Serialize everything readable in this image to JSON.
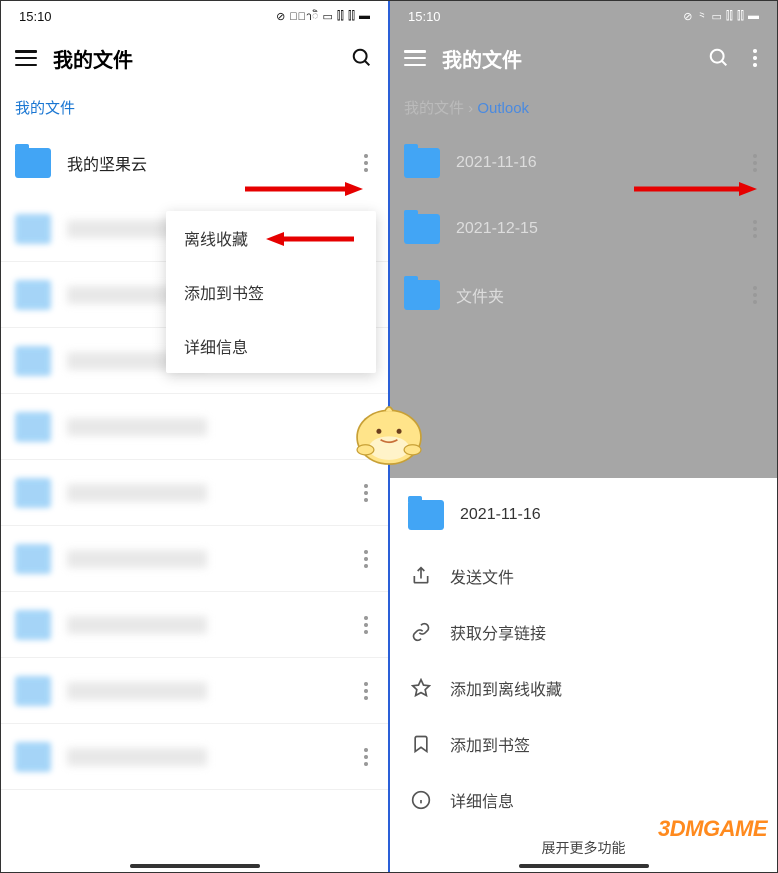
{
  "status": {
    "time": "15:10"
  },
  "left": {
    "title": "我的文件",
    "breadcrumb": "我的文件",
    "folder": "我的坚果云",
    "popup": {
      "offline": "离线收藏",
      "bookmark": "添加到书签",
      "details": "详细信息"
    }
  },
  "right": {
    "title": "我的文件",
    "crumb_root": "我的文件",
    "crumb_sep": " › ",
    "crumb_current": "Outlook",
    "folders": {
      "f1": "2021-11-16",
      "f2": "2021-12-15",
      "f3": "文件夹"
    },
    "sheet": {
      "title": "2021-11-16",
      "send": "发送文件",
      "link": "获取分享链接",
      "offline": "添加到离线收藏",
      "bookmark": "添加到书签",
      "details": "详细信息",
      "expand": "展开更多功能"
    }
  },
  "watermark": "3DMGAME"
}
